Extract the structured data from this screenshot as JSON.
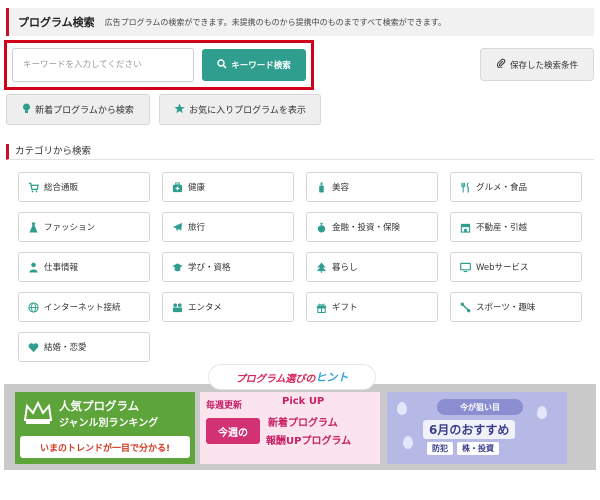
{
  "header": {
    "title": "プログラム検索",
    "description": "広告プログラムの検索ができます。未提携のものから提携中のものまですべて検索ができます。"
  },
  "search": {
    "placeholder": "キーワードを入力してください",
    "value": "",
    "button_label": "キーワード検索"
  },
  "saved_search_label": "保存した検索条件",
  "quick_buttons": {
    "new_programs": "新着プログラムから検索",
    "favorites": "お気に入りプログラムを表示"
  },
  "category_heading": "カテゴリから検索",
  "categories": [
    {
      "label": "総合通販",
      "icon": "cart-icon"
    },
    {
      "label": "健康",
      "icon": "medical-kit-icon"
    },
    {
      "label": "美容",
      "icon": "bottle-icon"
    },
    {
      "label": "グルメ・食品",
      "icon": "utensils-icon"
    },
    {
      "label": "ファッション",
      "icon": "dress-icon"
    },
    {
      "label": "旅行",
      "icon": "plane-icon"
    },
    {
      "label": "金融・投資・保険",
      "icon": "money-bag-icon"
    },
    {
      "label": "不動産・引越",
      "icon": "store-icon"
    },
    {
      "label": "仕事情報",
      "icon": "person-icon"
    },
    {
      "label": "学び・資格",
      "icon": "graduation-cap-icon"
    },
    {
      "label": "暮らし",
      "icon": "tree-icon"
    },
    {
      "label": "Webサービス",
      "icon": "monitor-icon"
    },
    {
      "label": "インターネット接続",
      "icon": "globe-icon"
    },
    {
      "label": "エンタメ",
      "icon": "people-icon"
    },
    {
      "label": "ギフト",
      "icon": "gift-icon"
    },
    {
      "label": "スポーツ・趣味",
      "icon": "dumbbell-icon"
    },
    {
      "label": "結婚・恋愛",
      "icon": "heart-icon"
    }
  ],
  "hint": {
    "prefix": "プログラム選びの",
    "accent": "ヒント"
  },
  "banners": {
    "ranking": {
      "line1": "人気プログラム",
      "line2": "ジャンル別ランキング",
      "bottom": "いまのトレンドが一目で分かる!"
    },
    "weekly": {
      "weekly": "毎週更新",
      "konshu": "今週の",
      "pickup": "Pick UP",
      "line1": "新着プログラム",
      "line2": "報酬UPプログラム"
    },
    "monthly": {
      "tag": "今が狙い目",
      "main": "6月のおすすめ",
      "chip1": "防犯",
      "chip2": "株・投資"
    }
  },
  "colors": {
    "accent_red": "#c8102e",
    "teal": "#2f9e8f",
    "icon_green": "#2f9e8f",
    "ranking_green": "#5da53a",
    "pink": "#d23273",
    "lavender": "#b6b8e6"
  }
}
